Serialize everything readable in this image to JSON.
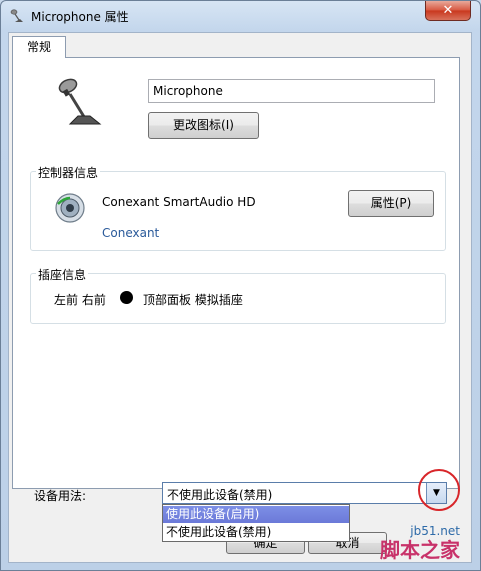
{
  "window": {
    "title": "Microphone 属性",
    "close_label": "✕"
  },
  "tabs": [
    {
      "label": "常规"
    }
  ],
  "device": {
    "name_value": "Microphone",
    "change_icon_label": "更改图标(I)"
  },
  "controller": {
    "legend": "控制器信息",
    "name": "Conexant SmartAudio HD",
    "vendor": "Conexant",
    "properties_label": "属性(P)"
  },
  "jack": {
    "legend": "插座信息",
    "position": "左前 右前",
    "dot_color": "#000000",
    "description": "顶部面板 模拟插座"
  },
  "usage": {
    "label": "设备用法:",
    "selected": "不使用此设备(禁用)",
    "options": [
      "使用此设备(启用)",
      "不使用此设备(禁用)"
    ]
  },
  "footer": {
    "ok_label": "确定",
    "cancel_label": "取消"
  },
  "watermark": {
    "url": "jb51.net",
    "name": "脚本之家"
  },
  "icons": {
    "title": "microphone-icon",
    "device": "microphone-stand-icon",
    "controller": "speaker-icon",
    "dropdown": "chevron-down-icon"
  },
  "colors": {
    "highlight": "#6b79d8",
    "annotation": "#d8262a",
    "link": "#2a5a9a"
  }
}
